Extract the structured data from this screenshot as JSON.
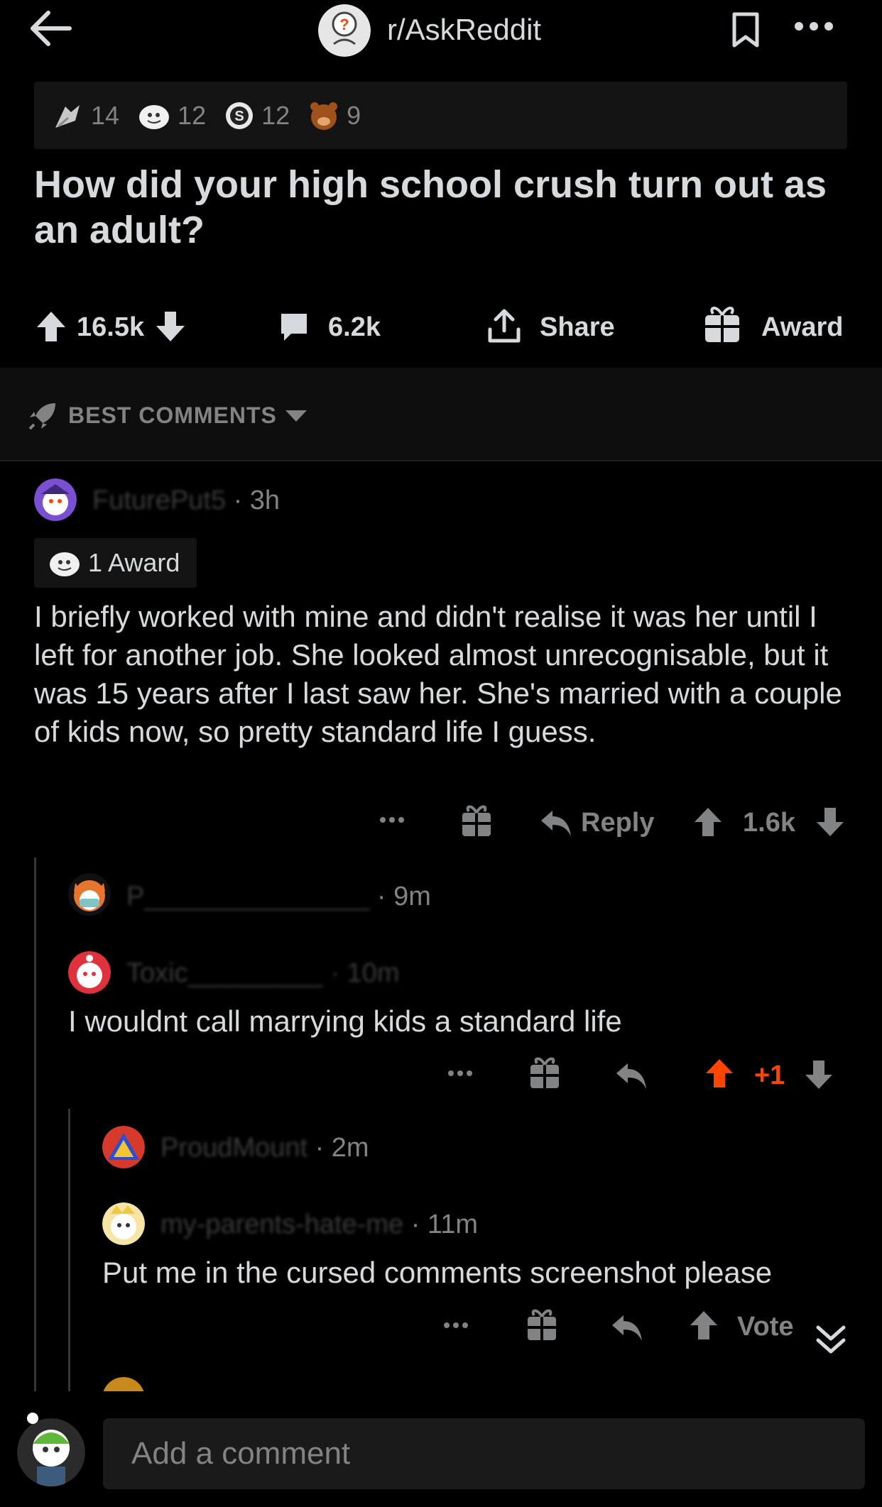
{
  "header": {
    "subreddit": "r/AskReddit",
    "back_icon": "back-arrow-icon",
    "bookmark_icon": "bookmark-icon",
    "more_icon": "more-icon"
  },
  "awards_bar": [
    {
      "icon": "silver-award-icon",
      "count": "14"
    },
    {
      "icon": "wholesome-award-icon",
      "count": "12"
    },
    {
      "icon": "gold-award-icon",
      "count": "12"
    },
    {
      "icon": "helpful-bear-award-icon",
      "count": "9"
    }
  ],
  "post": {
    "title": "How did your high school crush turn out as an adult?",
    "votes": "16.5k",
    "comments": "6.2k",
    "share_label": "Share",
    "award_label": "Award"
  },
  "sort": {
    "label": "BEST COMMENTS"
  },
  "comments": [
    {
      "user": "FuturePut5",
      "time": "· 3h",
      "award_badge": "1 Award",
      "body": "I briefly worked with mine and didn't realise it was her until I left for another job. She looked almost unrecognisable, but it was 15 years after I last saw her. She's married with a couple of kids now, so pretty standard life I guess.",
      "reply_label": "Reply",
      "votes": "1.6k"
    },
    {
      "user": "P_______________",
      "time": "· 9m"
    },
    {
      "user": "Toxic_________",
      "time": "· 10m",
      "body": "I wouldnt call marrying kids a standard life",
      "votes": "+1",
      "vote_color": "#ff4500"
    },
    {
      "user": "ProudMount",
      "time": "· 2m"
    },
    {
      "user": "my-parents-hate-me",
      "time": "· 11m",
      "body": "Put me in the cursed comments screenshot please",
      "votes": "Vote"
    }
  ],
  "footer": {
    "placeholder": "Add a comment"
  }
}
